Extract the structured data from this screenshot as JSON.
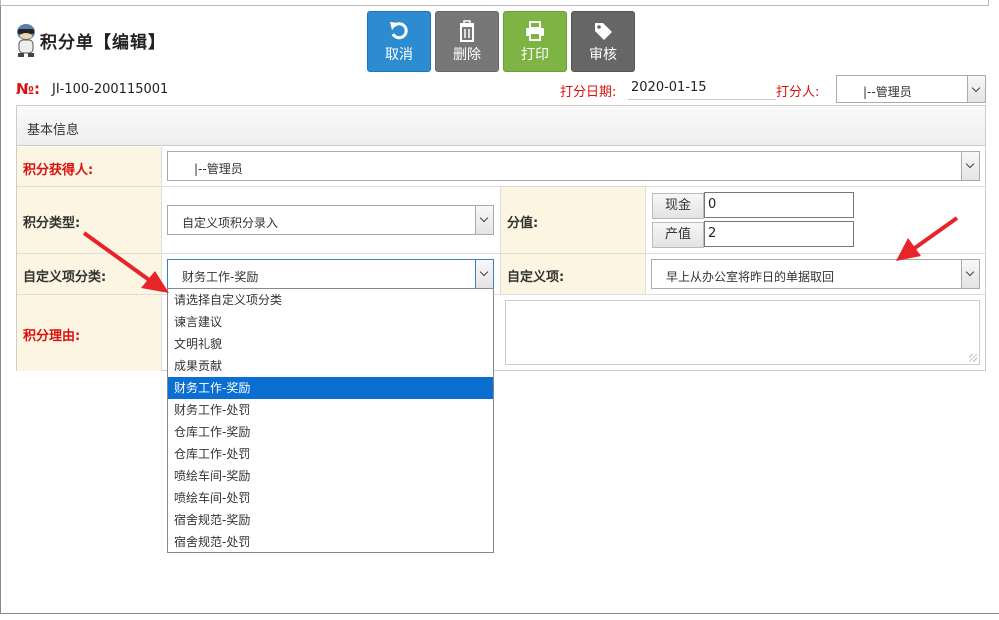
{
  "header": {
    "title": "积分单【编辑】"
  },
  "toolbar": {
    "cancel": "取消",
    "delete": "删除",
    "print": "打印",
    "audit": "审核"
  },
  "meta": {
    "no_label": "№:",
    "no_value": "JI-100-200115001",
    "date_label": "打分日期:",
    "date_value": "2020-01-15",
    "scorer_label": "打分人:",
    "scorer_value": "|--管理员"
  },
  "panel": {
    "title": "基本信息",
    "recipient_label": "积分获得人:",
    "recipient_value": "|--管理员",
    "type_label": "积分类型:",
    "type_value": "自定义项积分录入",
    "score_label": "分值:",
    "cash_label": "现金",
    "cash_value": "0",
    "output_label": "产值",
    "output_value": "2",
    "category_label": "自定义项分类:",
    "category_value": "财务工作-奖励",
    "item_label": "自定义项:",
    "item_value": "早上从办公室将昨日的单据取回",
    "reason_label": "积分理由:"
  },
  "dropdown": {
    "options": [
      "请选择自定义项分类",
      "谏言建议",
      "文明礼貌",
      "成果贡献",
      "财务工作-奖励",
      "财务工作-处罚",
      "仓库工作-奖励",
      "仓库工作-处罚",
      "喷绘车间-奖励",
      "喷绘车间-处罚",
      "宿舍规范-奖励",
      "宿舍规范-处罚"
    ],
    "selected_index": 4
  },
  "colors": {
    "required_label": "#d9120f",
    "label_bg": "#fbf5e2",
    "cancel_button": "#2d8ccf",
    "print_button": "#7db444",
    "selected_option": "#0a6fd1",
    "annotation_arrow": "#e8242b"
  },
  "icons": [
    "mascot-logo-icon",
    "undo-icon",
    "trash-icon",
    "printer-icon",
    "tag-icon"
  ]
}
